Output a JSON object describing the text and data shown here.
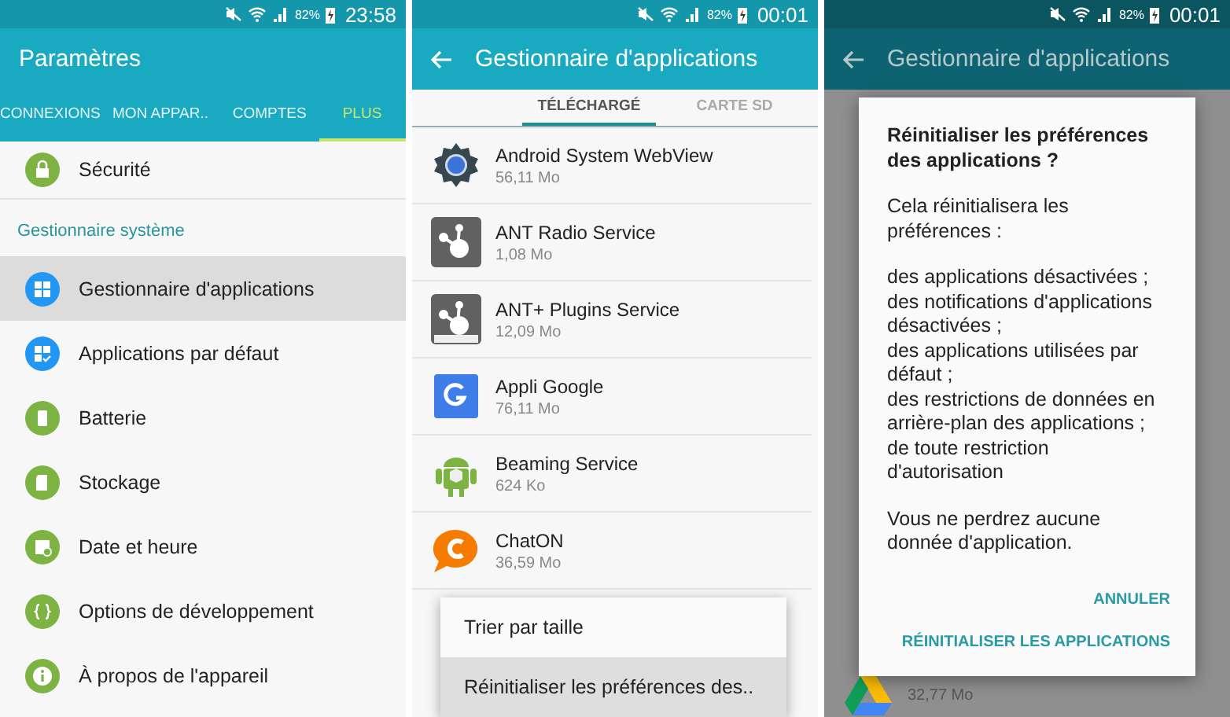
{
  "settings_screen": {
    "status_bar": {
      "battery": "82%",
      "time": "23:58"
    },
    "title": "Paramètres",
    "tabs": [
      {
        "label": "CONNEXIONS",
        "selected": false
      },
      {
        "label": "MON APPAR..",
        "selected": false
      },
      {
        "label": "COMPTES",
        "selected": false
      },
      {
        "label": "PLUS",
        "selected": true
      }
    ],
    "top_item": {
      "label": "Sécurité",
      "kind": "lock",
      "color": "#7cb342"
    },
    "section": "Gestionnaire système",
    "items": [
      {
        "label": "Gestionnaire d'applications",
        "kind": "grid",
        "color": "#2196f3",
        "selected": true
      },
      {
        "label": "Applications par défaut",
        "kind": "grid-check",
        "color": "#2196f3",
        "selected": false
      },
      {
        "label": "Batterie",
        "kind": "battery",
        "color": "#7cb342",
        "selected": false
      },
      {
        "label": "Stockage",
        "kind": "storage",
        "color": "#7cb342",
        "selected": false
      },
      {
        "label": "Date et heure",
        "kind": "calendar",
        "color": "#7cb342",
        "selected": false
      },
      {
        "label": "Options de développement",
        "kind": "braces",
        "color": "#7cb342",
        "selected": false
      },
      {
        "label": "À propos de l'appareil",
        "kind": "info",
        "color": "#7cb342",
        "selected": false
      }
    ]
  },
  "app_manager_screen": {
    "status_bar": {
      "battery": "82%",
      "time": "00:01"
    },
    "title": "Gestionnaire d'applications",
    "tabs": [
      {
        "label": "TÉLÉCHARGÉ",
        "selected": true
      },
      {
        "label": "CARTE SD",
        "selected": false
      }
    ],
    "apps": [
      {
        "name": "Android System WebView",
        "size": "56,11 Mo",
        "kind": "gear"
      },
      {
        "name": "ANT Radio Service",
        "size": "1,08 Mo",
        "kind": "ant"
      },
      {
        "name": "ANT+ Plugins Service",
        "size": "12,09 Mo",
        "kind": "ant-plus"
      },
      {
        "name": "Appli Google",
        "size": "76,11 Mo",
        "kind": "google"
      },
      {
        "name": "Beaming Service",
        "size": "624 Ko",
        "kind": "android"
      },
      {
        "name": "ChatON",
        "size": "36,59 Mo",
        "kind": "chat"
      }
    ],
    "menu": [
      {
        "label": "Trier par taille",
        "selected": false
      },
      {
        "label": "Réinitialiser les préférences des..",
        "selected": true
      }
    ]
  },
  "dialog_screen": {
    "status_bar": {
      "battery": "82%",
      "time": "00:01"
    },
    "title": "Gestionnaire d'applications",
    "background_app": {
      "size": "32,77 Mo",
      "kind": "drive"
    },
    "dialog": {
      "title": "Réinitialiser les préférences des applications ?",
      "intro": "Cela réinitialisera les préférences :",
      "items": [
        "des applications désactivées ;",
        "des notifications d'applications désactivées ;",
        "des applications utilisées par défaut ;",
        "des restrictions de données en arrière-plan des applications ;",
        "de toute restriction d'autorisation"
      ],
      "note": "Vous ne perdrez aucune donnée d'application.",
      "buttons": [
        "ANNULER",
        "RÉINITIALISER LES APPLICATIONS"
      ]
    }
  }
}
